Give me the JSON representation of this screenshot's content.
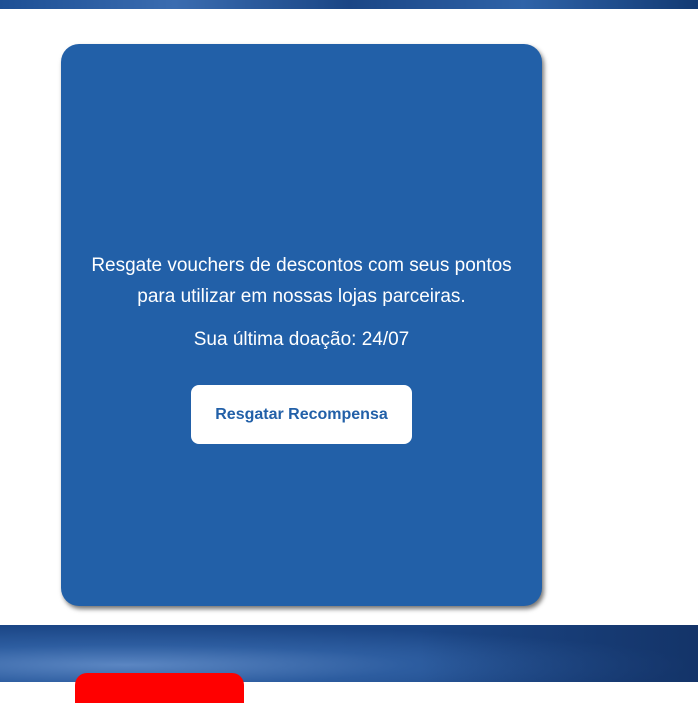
{
  "card": {
    "description": "Resgate vouchers de descontos com seus pontos para utilizar em nossas lojas parceiras.",
    "last_donation": "Sua última doação: 24/07",
    "redeem_label": "Resgatar Recompensa"
  },
  "colors": {
    "card_bg": "#2260a8",
    "button_bg": "#ffffff",
    "button_text": "#2260a8",
    "cta_red": "#ff0000"
  }
}
